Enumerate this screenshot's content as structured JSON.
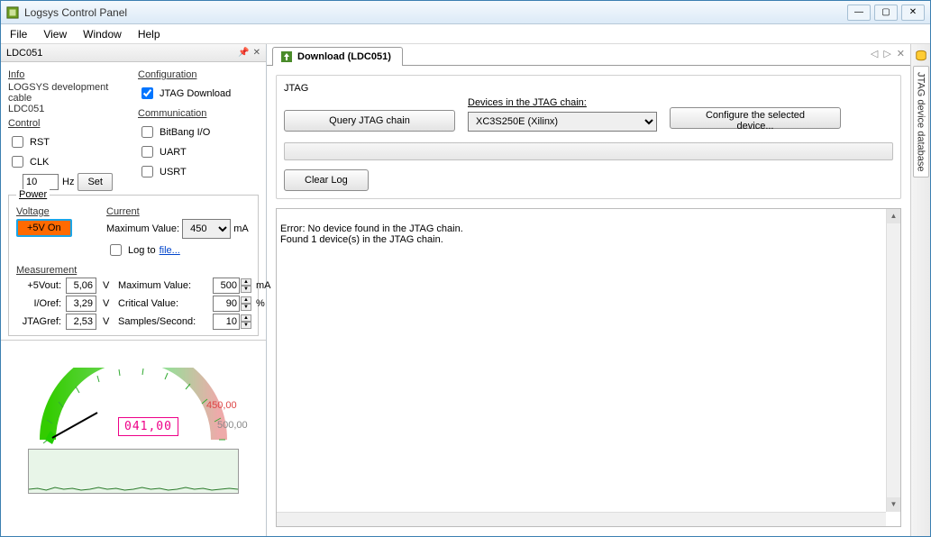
{
  "window": {
    "title": "Logsys Control Panel"
  },
  "menu": {
    "file": "File",
    "view": "View",
    "window": "Window",
    "help": "Help"
  },
  "left": {
    "header": "LDC051",
    "info_label": "Info",
    "info_text1": "LOGSYS development cable",
    "info_text2": "LDC051",
    "config_label": "Configuration",
    "jtag_dl": "JTAG Download",
    "control_label": "Control",
    "rst": "RST",
    "clk": "CLK",
    "freq_value": "10",
    "freq_unit": "Hz",
    "set_btn": "Set",
    "comm_label": "Communication",
    "bitbang": "BitBang I/O",
    "uart": "UART",
    "usrt": "USRT"
  },
  "power": {
    "legend": "Power",
    "voltage_label": "Voltage",
    "voltage_btn": "+5V On",
    "current_label": "Current",
    "max_label": "Maximum Value:",
    "max_value": "450",
    "ma": "mA",
    "log_label": "Log to",
    "log_link": "file...",
    "meas_label": "Measurement",
    "rows": [
      {
        "n": "+5Vout:",
        "v": "5,06",
        "u": "V",
        "p": "Maximum Value:",
        "pv": "500",
        "pu": "mA"
      },
      {
        "n": "I/Oref:",
        "v": "3,29",
        "u": "V",
        "p": "Critical Value:",
        "pv": "90",
        "pu": "%"
      },
      {
        "n": "JTAGref:",
        "v": "2,53",
        "u": "V",
        "p": "Samples/Second:",
        "pv": "10",
        "pu": ""
      }
    ]
  },
  "gauge": {
    "value": "041,00",
    "max_mark": "450,00",
    "full_mark": "500,00"
  },
  "tab": {
    "title": "Download (LDC051)"
  },
  "jtag": {
    "box_label": "JTAG",
    "query_btn": "Query JTAG chain",
    "devices_label": "Devices in the JTAG chain:",
    "device_selected": "XC3S250E (Xilinx)",
    "config_btn": "Configure the selected device...",
    "clear_btn": "Clear Log"
  },
  "log": "Error: No device found in the JTAG chain.\nFound 1 device(s) in the JTAG chain.",
  "dock": {
    "db": "JTAG device database"
  }
}
